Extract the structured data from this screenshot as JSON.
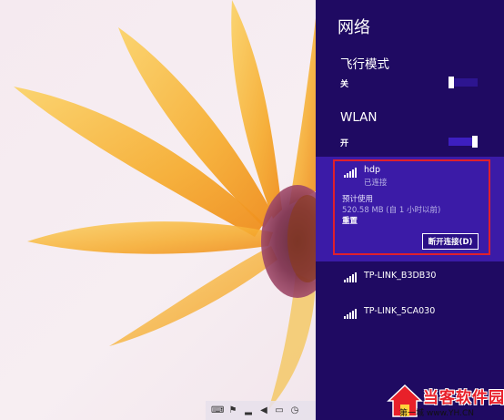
{
  "panel": {
    "title": "网络",
    "airplane_mode": {
      "heading": "飞行模式",
      "state": "关"
    },
    "wlan": {
      "heading": "WLAN",
      "state": "开"
    },
    "connected_network": {
      "name": "hdp",
      "status": "已连接",
      "usage_label": "预计使用",
      "usage_value": "520.58 MB (自 1 小时以前)",
      "reset_label": "重置",
      "disconnect_label": "断开连接(D)"
    },
    "networks": [
      {
        "name": "TP-LINK_B3DB30"
      },
      {
        "name": "TP-LINK_5CA030"
      }
    ]
  },
  "tray": {
    "icons": [
      "keyboard-icon",
      "flag-icon",
      "network-icon",
      "volume-icon",
      "battery-icon",
      "clock-icon"
    ]
  },
  "watermark": {
    "text": "当客软件园",
    "sub": "第一城 www.YH.CN"
  },
  "colors": {
    "panel_bg": "#1f0a62",
    "card_bg": "#3b1ba7",
    "highlight_border": "#e0202c",
    "toggle_track": "#3d1fc0"
  }
}
